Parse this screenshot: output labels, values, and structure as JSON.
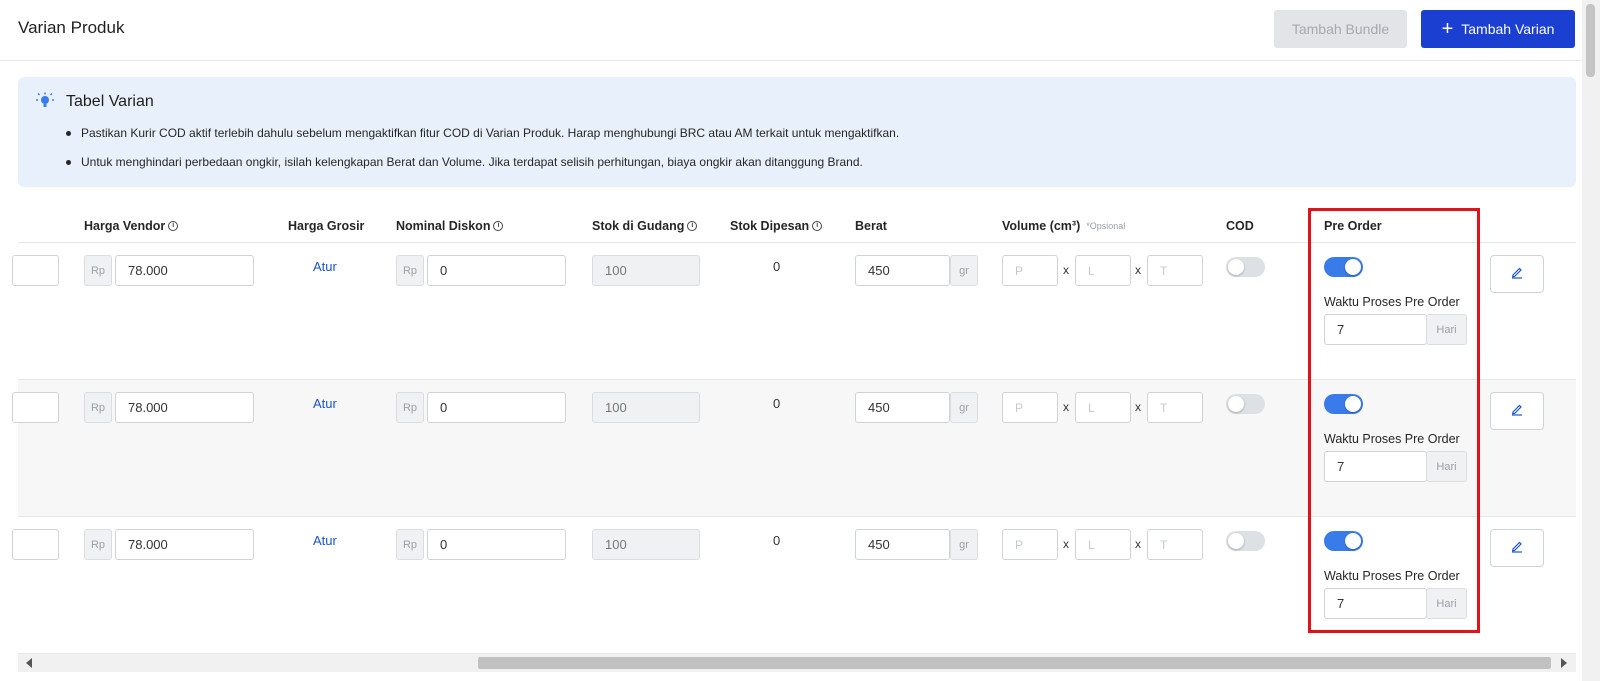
{
  "header": {
    "title": "Varian Produk",
    "bundle_button": "Tambah Bundle",
    "add_variant_button": "Tambah Varian",
    "add_variant_icon": "plus-icon"
  },
  "info": {
    "icon": "lightbulb-icon",
    "title": "Tabel Varian",
    "items": [
      "Pastikan Kurir COD aktif terlebih dahulu sebelum mengaktifkan fitur COD di Varian Produk. Harap menghubungi BRC atau AM terkait untuk mengaktifkan.",
      "Untuk menghindari perbedaan ongkir, isilah kelengkapan Berat dan Volume. Jika terdapat selisih perhitungan, biaya ongkir akan ditanggung Brand."
    ]
  },
  "table": {
    "headers": {
      "harga_vendor": "Harga Vendor",
      "harga_grosir": "Harga Grosir",
      "nominal_diskon": "Nominal Diskon",
      "stok_gudang": "Stok di Gudang",
      "stok_dipesan": "Stok Dipesan",
      "berat": "Berat",
      "volume": "Volume (cm³)",
      "volume_note": "*Opsional",
      "cod": "COD",
      "pre_order": "Pre Order",
      "info_icon": "info-circle-icon"
    },
    "units": {
      "currency": "Rp",
      "weight": "gr",
      "days": "Hari",
      "multiply": "x"
    },
    "placeholders": {
      "p": "P",
      "l": "L",
      "t": "T"
    },
    "labels": {
      "atur": "Atur",
      "po_time": "Waktu Proses Pre Order",
      "edit_icon": "pencil-icon"
    },
    "rows": [
      {
        "harga_vendor": "78.000",
        "diskon": "0",
        "stok_gudang": "100",
        "stok_dipesan": "0",
        "berat": "450",
        "cod": false,
        "pre_order": true,
        "po_days": "7"
      },
      {
        "harga_vendor": "78.000",
        "diskon": "0",
        "stok_gudang": "100",
        "stok_dipesan": "0",
        "berat": "450",
        "cod": false,
        "pre_order": true,
        "po_days": "7"
      },
      {
        "harga_vendor": "78.000",
        "diskon": "0",
        "stok_gudang": "100",
        "stok_dipesan": "0",
        "berat": "450",
        "cod": false,
        "pre_order": true,
        "po_days": "7"
      }
    ]
  },
  "colors": {
    "primary": "#1a3fd1",
    "toggle_on": "#3a7bea",
    "highlight": "#e0131a",
    "info_bg": "#e8f1fb"
  }
}
